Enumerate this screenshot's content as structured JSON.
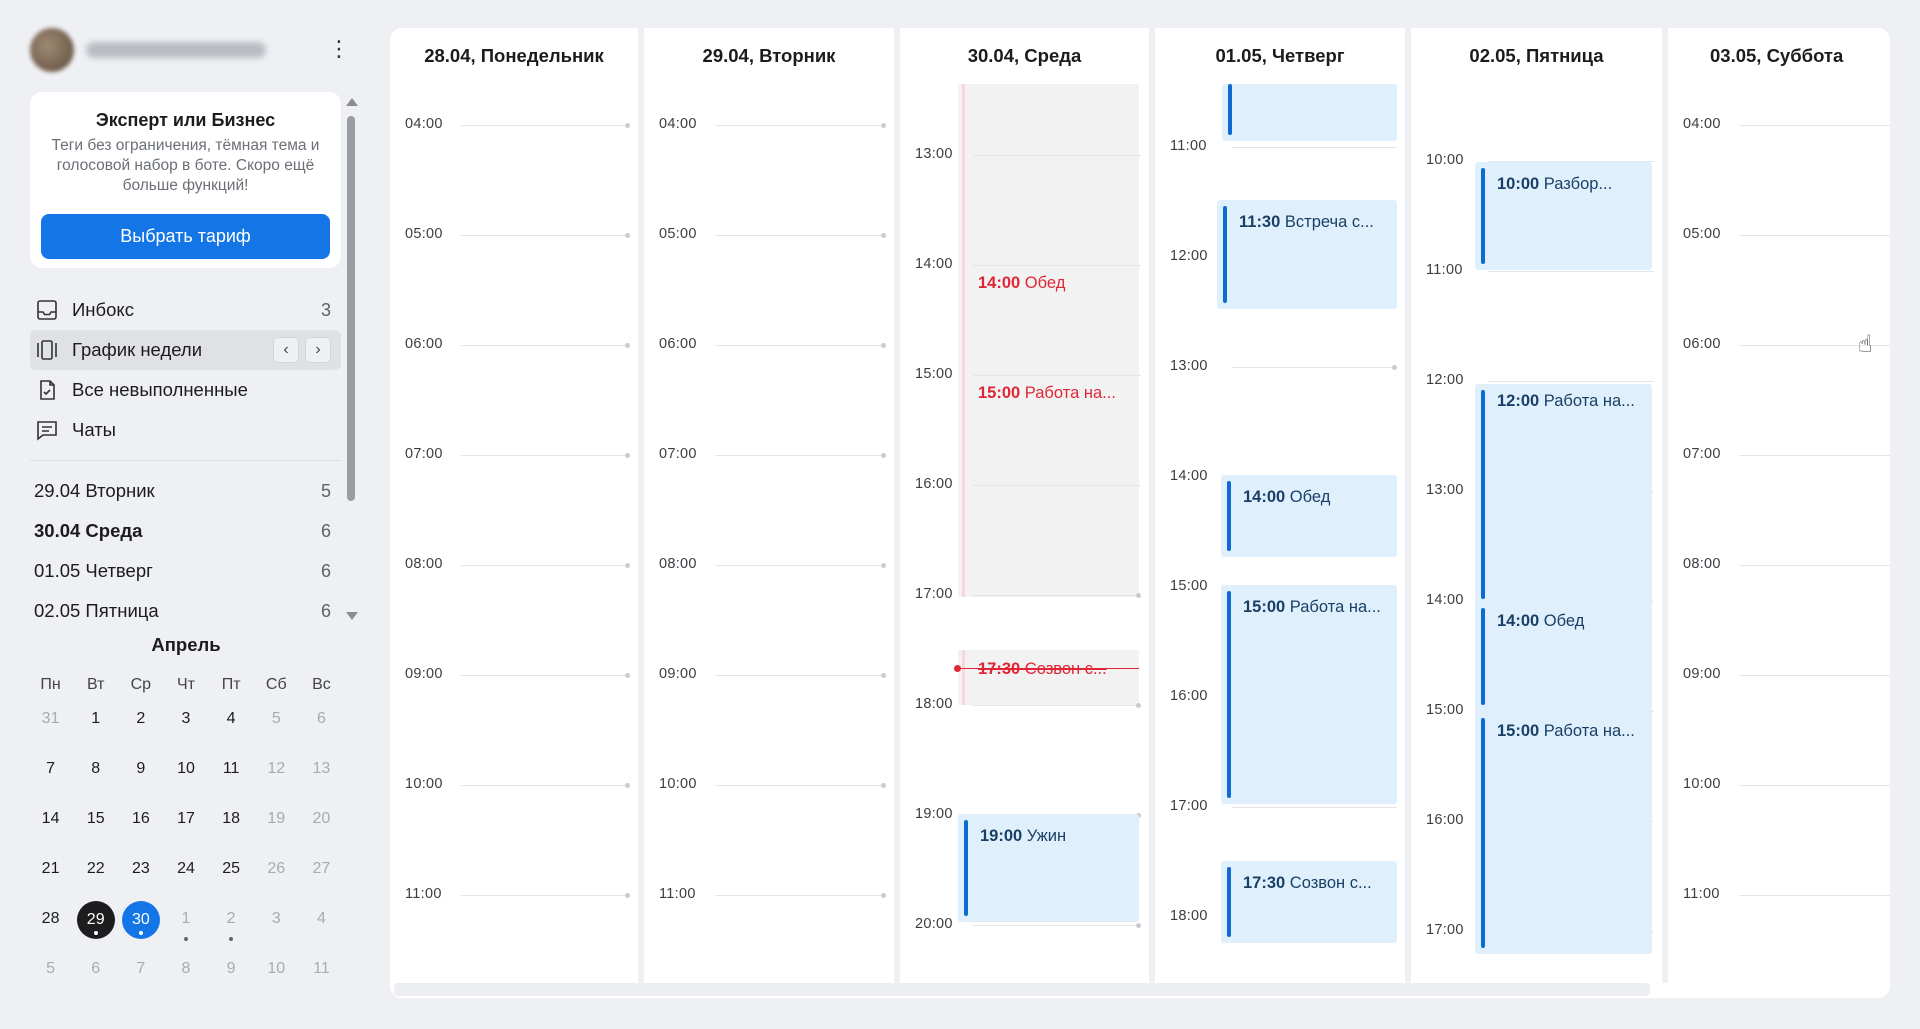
{
  "sidebar": {
    "promo": {
      "title": "Эксперт или Бизнес",
      "text": "Теги без ограничения, тёмная тема и голосовой набор в боте. Скоро ещё больше функций!",
      "button": "Выбрать тариф"
    },
    "nav": [
      {
        "label": "Инбокс",
        "count": "3",
        "icon": "inbox-icon"
      },
      {
        "label": "График недели",
        "count": "",
        "icon": "week-schedule-icon"
      },
      {
        "label": "Все невыполненные",
        "count": "",
        "icon": "task-check-icon"
      },
      {
        "label": "Чаты",
        "count": "",
        "icon": "chat-icon"
      }
    ],
    "week_prev": "‹",
    "week_next": "›",
    "days": [
      {
        "label": "29.04 Вторник",
        "count": "5"
      },
      {
        "label": "30.04 Среда",
        "count": "6"
      },
      {
        "label": "01.05 Четверг",
        "count": "6"
      },
      {
        "label": "02.05 Пятница",
        "count": "6"
      }
    ],
    "mini_calendar": {
      "month": "Апрель",
      "weekdays": [
        "Пн",
        "Вт",
        "Ср",
        "Чт",
        "Пт",
        "Сб",
        "Вс"
      ]
    }
  },
  "calendar": {
    "columns": [
      {
        "header": "28.04, Понедельник"
      },
      {
        "header": "29.04, Вторник"
      },
      {
        "header": "30.04, Среда"
      },
      {
        "header": "01.05, Четверг"
      },
      {
        "header": "02.05, Пятница"
      },
      {
        "header": "03.05, Суббота"
      }
    ],
    "hours_early": [
      "04:00",
      "05:00",
      "06:00",
      "07:00",
      "08:00",
      "09:00",
      "10:00",
      "11:00"
    ],
    "hours_wed": [
      "13:00",
      "14:00",
      "15:00",
      "16:00",
      "17:00",
      "18:00",
      "19:00",
      "20:00"
    ],
    "hours_thu": [
      "11:00",
      "12:00",
      "13:00",
      "14:00",
      "15:00",
      "16:00",
      "17:00",
      "18:00"
    ],
    "hours_fri": [
      "10:00",
      "11:00",
      "12:00",
      "13:00",
      "14:00",
      "15:00",
      "16:00",
      "17:00"
    ],
    "events": {
      "wed_lunch_time": "14:00",
      "wed_lunch_title": "Обед",
      "wed_work_time": "15:00",
      "wed_work_title": "Работа на...",
      "wed_call_time": "17:30",
      "wed_call_title": "Созвон с...",
      "wed_dinner_time": "19:00",
      "wed_dinner_title": "Ужин",
      "thu_meet_time": "11:30",
      "thu_meet_title": "Встреча с...",
      "thu_lunch_time": "14:00",
      "thu_lunch_title": "Обед",
      "thu_work_time": "15:00",
      "thu_work_title": "Работа на...",
      "thu_call_time": "17:30",
      "thu_call_title": "Созвон с...",
      "fri_review_time": "10:00",
      "fri_review_title": "Разбор...",
      "fri_work1_time": "12:00",
      "fri_work1_title": "Работа на...",
      "fri_lunch_time": "14:00",
      "fri_lunch_title": "Обед",
      "fri_work2_time": "15:00",
      "fri_work2_title": "Работа на..."
    }
  }
}
